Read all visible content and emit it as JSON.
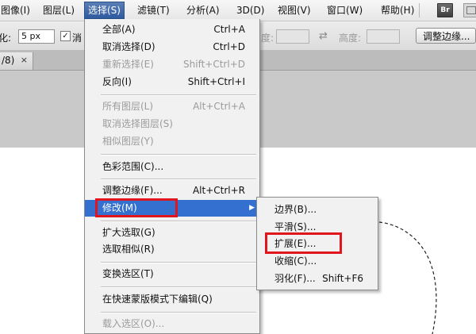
{
  "menubar": {
    "items": [
      {
        "label": "图像(I)",
        "name": "menu-image"
      },
      {
        "label": "图层(L)",
        "name": "menu-layer"
      },
      {
        "label": "选择(S)",
        "name": "menu-select",
        "active": true
      },
      {
        "label": "滤镜(T)",
        "name": "menu-filter"
      },
      {
        "label": "分析(A)",
        "name": "menu-analysis"
      },
      {
        "label": "3D(D)",
        "name": "menu-3d"
      },
      {
        "label": "视图(V)",
        "name": "menu-view"
      },
      {
        "label": "窗口(W)",
        "name": "menu-window"
      },
      {
        "label": "帮助(H)",
        "name": "menu-help"
      }
    ],
    "bridge_icon_text": "Br"
  },
  "options_bar": {
    "feather_label": "化:",
    "feather_value": "5 px",
    "antialias_label": "消",
    "antialias_check": "✓",
    "width_label": "度:",
    "height_label": "高度:",
    "swap_glyph": "⇄",
    "refine_edge_label": "调整边缘..."
  },
  "document_tab": {
    "label": "/8)",
    "close_glyph": "×"
  },
  "select_menu": {
    "items": [
      {
        "label": "全部(A)",
        "shortcut": "Ctrl+A",
        "disabled": false
      },
      {
        "label": "取消选择(D)",
        "shortcut": "Ctrl+D",
        "disabled": false
      },
      {
        "label": "重新选择(E)",
        "shortcut": "Shift+Ctrl+D",
        "disabled": true
      },
      {
        "label": "反向(I)",
        "shortcut": "Shift+Ctrl+I",
        "disabled": false
      },
      {
        "label": "所有图层(L)",
        "shortcut": "Alt+Ctrl+A",
        "disabled": true
      },
      {
        "label": "取消选择图层(S)",
        "shortcut": "",
        "disabled": true
      },
      {
        "label": "相似图层(Y)",
        "shortcut": "",
        "disabled": true
      },
      {
        "label": "色彩范围(C)...",
        "shortcut": "",
        "disabled": false
      },
      {
        "label": "调整边缘(F)...",
        "shortcut": "Alt+Ctrl+R",
        "disabled": false
      },
      {
        "label": "修改(M)",
        "shortcut": "",
        "disabled": false,
        "highlighted": true,
        "submenu": true
      },
      {
        "label": "扩大选取(G)",
        "shortcut": "",
        "disabled": false
      },
      {
        "label": "选取相似(R)",
        "shortcut": "",
        "disabled": false
      },
      {
        "label": "变换选区(T)",
        "shortcut": "",
        "disabled": false
      },
      {
        "label": "在快速蒙版模式下编辑(Q)",
        "shortcut": "",
        "disabled": false
      },
      {
        "label": "载入选区(O)...",
        "shortcut": "",
        "disabled": true
      }
    ],
    "submenu_arrow": "▶"
  },
  "modify_submenu": {
    "items": [
      {
        "label": "边界(B)...",
        "shortcut": ""
      },
      {
        "label": "平滑(S)...",
        "shortcut": ""
      },
      {
        "label": "扩展(E)...",
        "shortcut": ""
      },
      {
        "label": "收缩(C)...",
        "shortcut": ""
      },
      {
        "label": "羽化(F)...",
        "shortcut": "Shift+F6"
      }
    ]
  },
  "colors": {
    "highlight": "#3370cf",
    "annotation_red": "#e0151d"
  }
}
